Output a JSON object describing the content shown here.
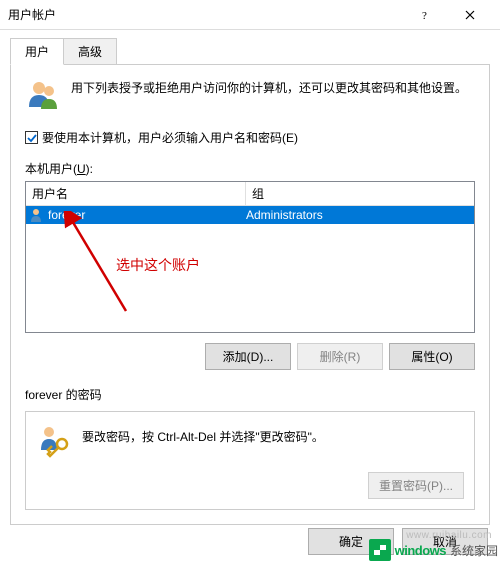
{
  "window": {
    "title": "用户帐户"
  },
  "tabs": {
    "user": "用户",
    "advanced": "高级"
  },
  "intro": {
    "text": "用下列表授予或拒绝用户访问你的计算机，还可以更改其密码和其他设置。"
  },
  "checkbox": {
    "label": "要使用本计算机，用户必须输入用户名和密码(E)"
  },
  "list": {
    "label_prefix": "本机用户(",
    "label_hotkey": "U",
    "label_suffix": "):",
    "col_user": "用户名",
    "col_group": "组",
    "rows": [
      {
        "user": "forever",
        "group": "Administrators"
      }
    ]
  },
  "annotation": {
    "text": "选中这个账户"
  },
  "buttons": {
    "add": "添加(D)...",
    "remove": "删除(R)",
    "properties": "属性(O)"
  },
  "password": {
    "section_label": "forever 的密码",
    "text": "要改密码，按 Ctrl-Alt-Del 并选择\"更改密码\"。",
    "reset": "重置密码(P)..."
  },
  "footer": {
    "ok": "确定",
    "cancel": "取消"
  },
  "watermark": {
    "url": "www.ruihailu.com",
    "brand1": "windows",
    "brand2": "系统家园"
  }
}
